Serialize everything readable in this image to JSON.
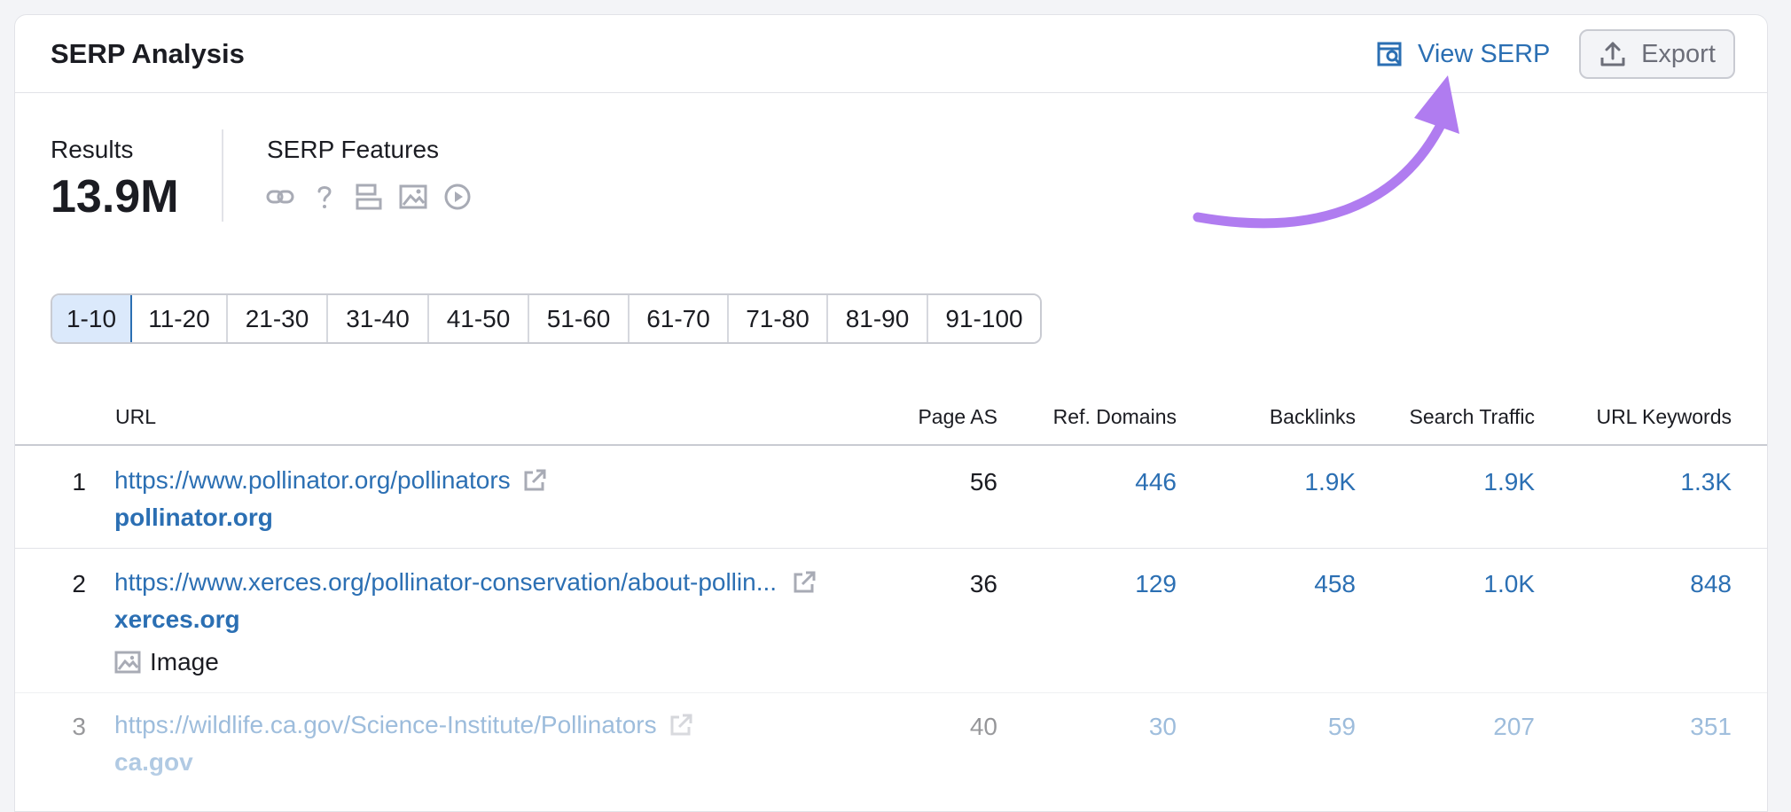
{
  "header": {
    "title": "SERP Analysis",
    "view_serp_label": "View SERP",
    "export_label": "Export"
  },
  "summary": {
    "results_label": "Results",
    "results_value": "13.9M",
    "features_label": "SERP Features",
    "feature_icons": [
      "link-icon",
      "question-icon",
      "snippet-icon",
      "image-icon",
      "video-icon"
    ]
  },
  "pagination": [
    "1-10",
    "11-20",
    "21-30",
    "31-40",
    "41-50",
    "51-60",
    "61-70",
    "71-80",
    "81-90",
    "91-100"
  ],
  "pagination_active": "1-10",
  "table": {
    "columns": {
      "url": "URL",
      "page_as": "Page AS",
      "ref_domains": "Ref. Domains",
      "backlinks": "Backlinks",
      "search_traffic": "Search Traffic",
      "url_keywords": "URL Keywords"
    },
    "rows": [
      {
        "num": "1",
        "url": "https://www.pollinator.org/pollinators",
        "domain": "pollinator.org",
        "page_as": "56",
        "ref_domains": "446",
        "backlinks": "1.9K",
        "search_traffic": "1.9K",
        "url_keywords": "1.3K"
      },
      {
        "num": "2",
        "url": "https://www.xerces.org/pollinator-conservation/about-pollin...",
        "domain": "xerces.org",
        "feature": "Image",
        "page_as": "36",
        "ref_domains": "129",
        "backlinks": "458",
        "search_traffic": "1.0K",
        "url_keywords": "848"
      },
      {
        "num": "3",
        "url": "https://wildlife.ca.gov/Science-Institute/Pollinators",
        "domain": "ca.gov",
        "page_as": "40",
        "ref_domains": "30",
        "backlinks": "59",
        "search_traffic": "207",
        "url_keywords": "351"
      }
    ]
  },
  "colors": {
    "link": "#2b6fb3",
    "text": "#1b1c22",
    "border": "#e2e3e8",
    "active_page_bg": "#dbe9fb",
    "annotation_arrow": "#b07cf0"
  }
}
